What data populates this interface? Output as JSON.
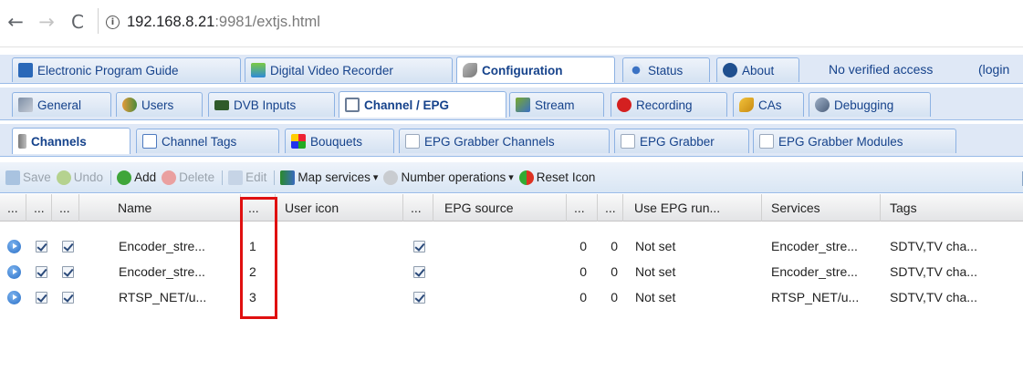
{
  "browser": {
    "back_glyph": "←",
    "forward_glyph": "→",
    "reload_glyph": "C",
    "info_glyph": "i",
    "url_host": "192.168.8.21",
    "url_rest": ":9981/extjs.html"
  },
  "main_tabs": {
    "items": [
      {
        "label": "Electronic Program Guide",
        "icon": "epg-icon"
      },
      {
        "label": "Digital Video Recorder",
        "icon": "dvr-icon"
      },
      {
        "label": "Configuration",
        "icon": "wrench-icon",
        "active": true
      },
      {
        "label": "Status",
        "icon": "eye-icon"
      },
      {
        "label": "About",
        "icon": "info-icon"
      }
    ],
    "access_text": "No verified access",
    "login_text": "(login"
  },
  "config_tabs": {
    "items": [
      {
        "label": "General",
        "icon": "tools-icon"
      },
      {
        "label": "Users",
        "icon": "users-icon"
      },
      {
        "label": "DVB Inputs",
        "icon": "dvb-icon"
      },
      {
        "label": "Channel / EPG",
        "icon": "tv-icon",
        "active": true
      },
      {
        "label": "Stream",
        "icon": "stream-icon"
      },
      {
        "label": "Recording",
        "icon": "rec-icon"
      },
      {
        "label": "CAs",
        "icon": "key-icon"
      },
      {
        "label": "Debugging",
        "icon": "debug-icon"
      }
    ]
  },
  "channel_tabs": {
    "items": [
      {
        "label": "Channels",
        "icon": "remote-icon",
        "active": true
      },
      {
        "label": "Channel Tags",
        "icon": "tags-icon"
      },
      {
        "label": "Bouquets",
        "icon": "bouquet-icon"
      },
      {
        "label": "EPG Grabber Channels",
        "icon": "grabber-icon"
      },
      {
        "label": "EPG Grabber",
        "icon": "grabber-icon"
      },
      {
        "label": "EPG Grabber Modules",
        "icon": "grabber-icon"
      }
    ]
  },
  "toolbar": {
    "save": "Save",
    "undo": "Undo",
    "add": "Add",
    "delete": "Delete",
    "edit": "Edit",
    "map_services": "Map services",
    "number_operations": "Number operations",
    "reset_icon": "Reset Icon",
    "dropdown_glyph": "▾"
  },
  "grid": {
    "headers": {
      "col0": "...",
      "col1": "...",
      "col2": "...",
      "name": "Name",
      "number": "...",
      "user_icon": "User icon",
      "col6": "...",
      "epg_source": "EPG source",
      "col8": "...",
      "col9": "...",
      "use_epg_running": "Use EPG run...",
      "services": "Services",
      "tags": "Tags"
    },
    "rows": [
      {
        "name": "Encoder_stre...",
        "number": "1",
        "c8": "0",
        "c9": "0",
        "epg_running": "Not set",
        "services": "Encoder_stre...",
        "tags": "SDTV,TV cha..."
      },
      {
        "name": "Encoder_stre...",
        "number": "2",
        "c8": "0",
        "c9": "0",
        "epg_running": "Not set",
        "services": "Encoder_stre...",
        "tags": "SDTV,TV cha..."
      },
      {
        "name": "RTSP_NET/u...",
        "number": "3",
        "c8": "0",
        "c9": "0",
        "epg_running": "Not set",
        "services": "RTSP_NET/u...",
        "tags": "SDTV,TV cha..."
      }
    ]
  },
  "colors": {
    "accent": "#15428b",
    "highlight": "#e01010",
    "tab_border": "#8db2e3"
  }
}
